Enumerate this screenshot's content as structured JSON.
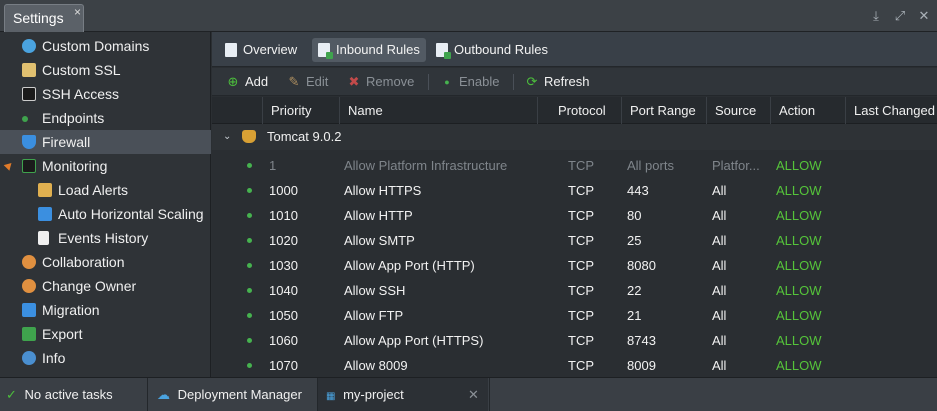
{
  "window": {
    "tab_title": "Settings",
    "tab_close": "×",
    "controls": [
      "download-icon",
      "expand-icon",
      "close-icon"
    ]
  },
  "sidebar": {
    "items": [
      {
        "label": "Custom Domains",
        "icon": "globe-icon",
        "color": "#4aa3df"
      },
      {
        "label": "Custom SSL",
        "icon": "certificate-icon",
        "color": "#e0c070"
      },
      {
        "label": "SSH Access",
        "icon": "terminal-icon",
        "color": "#1b1b1b"
      },
      {
        "label": "Endpoints",
        "icon": "endpoints-icon",
        "color": "#3fa34d"
      },
      {
        "label": "Firewall",
        "icon": "shield-icon",
        "color": "#3b8fe0"
      },
      {
        "label": "Monitoring",
        "icon": "chart-icon",
        "color": "#3fa34d"
      },
      {
        "label": "Load Alerts",
        "icon": "mail-alert-icon",
        "color": "#e0b050"
      },
      {
        "label": "Auto Horizontal Scaling",
        "icon": "scaling-icon",
        "color": "#3b8fe0"
      },
      {
        "label": "Events History",
        "icon": "document-icon",
        "color": "#f0f0f0"
      },
      {
        "label": "Collaboration",
        "icon": "users-icon",
        "color": "#e09040"
      },
      {
        "label": "Change Owner",
        "icon": "user-swap-icon",
        "color": "#e09040"
      },
      {
        "label": "Migration",
        "icon": "migration-icon",
        "color": "#3b8fe0"
      },
      {
        "label": "Export",
        "icon": "export-icon",
        "color": "#3fa34d"
      },
      {
        "label": "Info",
        "icon": "info-icon",
        "color": "#4a8fd0"
      }
    ],
    "active": "Firewall"
  },
  "tabs": [
    {
      "label": "Overview",
      "icon": "overview-icon"
    },
    {
      "label": "Inbound Rules",
      "icon": "inbound-icon"
    },
    {
      "label": "Outbound Rules",
      "icon": "outbound-icon"
    }
  ],
  "active_tab": "Inbound Rules",
  "toolbar": {
    "add": "Add",
    "edit": "Edit",
    "remove": "Remove",
    "enable": "Enable",
    "refresh": "Refresh"
  },
  "columns": [
    "Priority",
    "Name",
    "Protocol",
    "Port Range",
    "Source",
    "Action",
    "Last Changed"
  ],
  "group": {
    "name": "Tomcat 9.0.2",
    "icon": "tomcat-icon"
  },
  "rules": [
    {
      "priority": "1",
      "name": "Allow Platform Infrastructure",
      "protocol": "TCP",
      "ports": "All ports",
      "source": "Platfor...",
      "action": "ALLOW",
      "muted": true
    },
    {
      "priority": "1000",
      "name": "Allow HTTPS",
      "protocol": "TCP",
      "ports": "443",
      "source": "All",
      "action": "ALLOW"
    },
    {
      "priority": "1010",
      "name": "Allow HTTP",
      "protocol": "TCP",
      "ports": "80",
      "source": "All",
      "action": "ALLOW"
    },
    {
      "priority": "1020",
      "name": "Allow SMTP",
      "protocol": "TCP",
      "ports": "25",
      "source": "All",
      "action": "ALLOW"
    },
    {
      "priority": "1030",
      "name": "Allow App Port (HTTP)",
      "protocol": "TCP",
      "ports": "8080",
      "source": "All",
      "action": "ALLOW"
    },
    {
      "priority": "1040",
      "name": "Allow SSH",
      "protocol": "TCP",
      "ports": "22",
      "source": "All",
      "action": "ALLOW"
    },
    {
      "priority": "1050",
      "name": "Allow FTP",
      "protocol": "TCP",
      "ports": "21",
      "source": "All",
      "action": "ALLOW"
    },
    {
      "priority": "1060",
      "name": "Allow App Port (HTTPS)",
      "protocol": "TCP",
      "ports": "8743",
      "source": "All",
      "action": "ALLOW"
    },
    {
      "priority": "1070",
      "name": "Allow 8009",
      "protocol": "TCP",
      "ports": "8009",
      "source": "All",
      "action": "ALLOW"
    }
  ],
  "statusbar": {
    "tasks": "No active tasks",
    "deployment_manager": "Deployment Manager",
    "project": "my-project"
  },
  "colors": {
    "allow": "#55c43a",
    "status_dot": "#46b24f",
    "accent": "#3b8fe0"
  }
}
